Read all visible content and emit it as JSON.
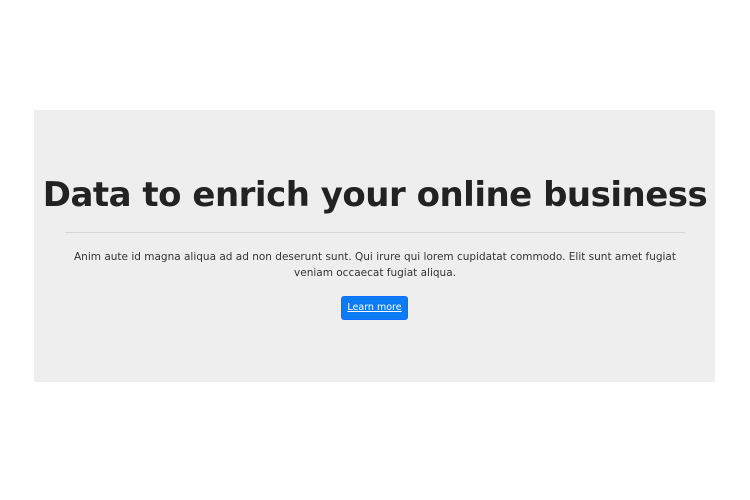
{
  "hero": {
    "title": "Data to enrich your online business",
    "description": "Anim aute id magna aliqua ad ad non deserunt sunt. Qui irure qui lorem cupidatat commodo. Elit sunt amet fugiat veniam occaecat fugiat aliqua.",
    "button_label": "Learn more"
  },
  "colors": {
    "hero_background": "#eeeeee",
    "button_background": "#0d7cf2",
    "title_text": "#222222"
  }
}
